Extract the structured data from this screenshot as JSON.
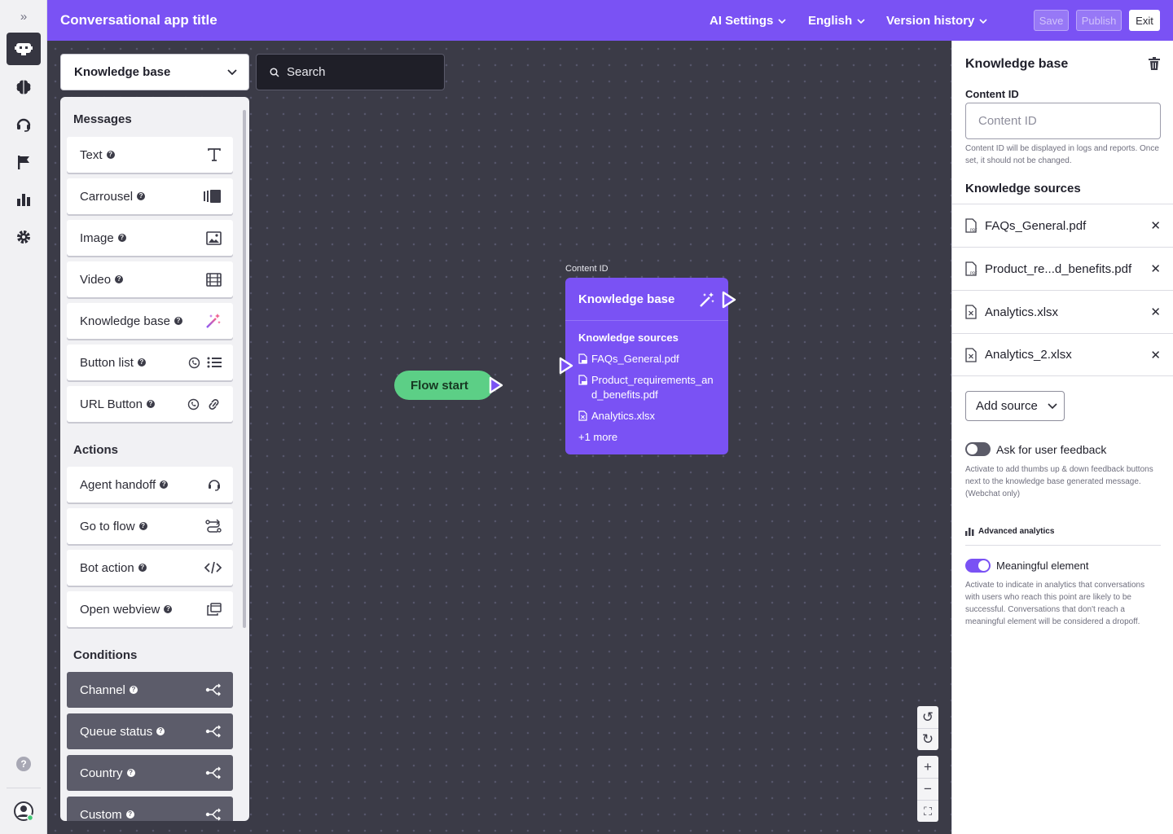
{
  "app": {
    "title": "Conversational app title"
  },
  "topbar": {
    "menus": [
      "AI Settings",
      "English",
      "Version history"
    ],
    "save": "Save",
    "publish": "Publish",
    "exit": "Exit"
  },
  "rail": {
    "icons": [
      "bot-icon",
      "brain-icon",
      "headset-icon",
      "flag-icon",
      "bar-chart-icon",
      "gear-icon"
    ],
    "help": "?"
  },
  "palette": {
    "selector": "Knowledge base",
    "search_placeholder": "Search",
    "messages_title": "Messages",
    "messages": [
      "Text",
      "Carrousel",
      "Image",
      "Video",
      "Knowledge base",
      "Button list",
      "URL Button"
    ],
    "actions_title": "Actions",
    "actions": [
      "Agent handoff",
      "Go to flow",
      "Bot action",
      "Open webview"
    ],
    "conditions_title": "Conditions",
    "conditions": [
      "Channel",
      "Queue status",
      "Country",
      "Custom"
    ],
    "help_glyph": "?"
  },
  "canvas": {
    "flow_start": "Flow start",
    "node": {
      "content_id_label": "Content ID",
      "title": "Knowledge base",
      "sources_title": "Knowledge sources",
      "sources": [
        "FAQs_General.pdf",
        "Product_requirements_and_benefits.pdf",
        "Analytics.xlsx"
      ],
      "more": "+1 more"
    },
    "zoom": {
      "undo": "↺",
      "redo": "↻",
      "in": "+",
      "out": "−",
      "fit": "⛶"
    }
  },
  "panel": {
    "title": "Knowledge base",
    "content_id_label": "Content ID",
    "content_id_placeholder": "Content ID",
    "content_id_help": "Content ID will be displayed in logs and reports. Once set, it should not be changed.",
    "sources_title": "Knowledge sources",
    "sources": [
      "FAQs_General.pdf",
      "Product_re...d_benefits.pdf",
      "Analytics.xlsx",
      "Analytics_2.xlsx"
    ],
    "add_source": "Add source",
    "feedback_label": "Ask for user feedback",
    "feedback_on": false,
    "feedback_help": "Activate to add thumbs up & down feedback buttons next to the knowledge base generated message. (Webchat only)",
    "advanced_title": "Advanced analytics",
    "meaningful_label": "Meaningful element",
    "meaningful_on": true,
    "meaningful_help": "Activate to indicate in analytics that conversations with users who reach this point are likely to be successful. Conversations that don't reach a meaningful element will be considered a dropoff."
  },
  "colors": {
    "brand": "#7a52f4",
    "flow_start": "#5ccf86",
    "canvas": "#3b3b47"
  }
}
